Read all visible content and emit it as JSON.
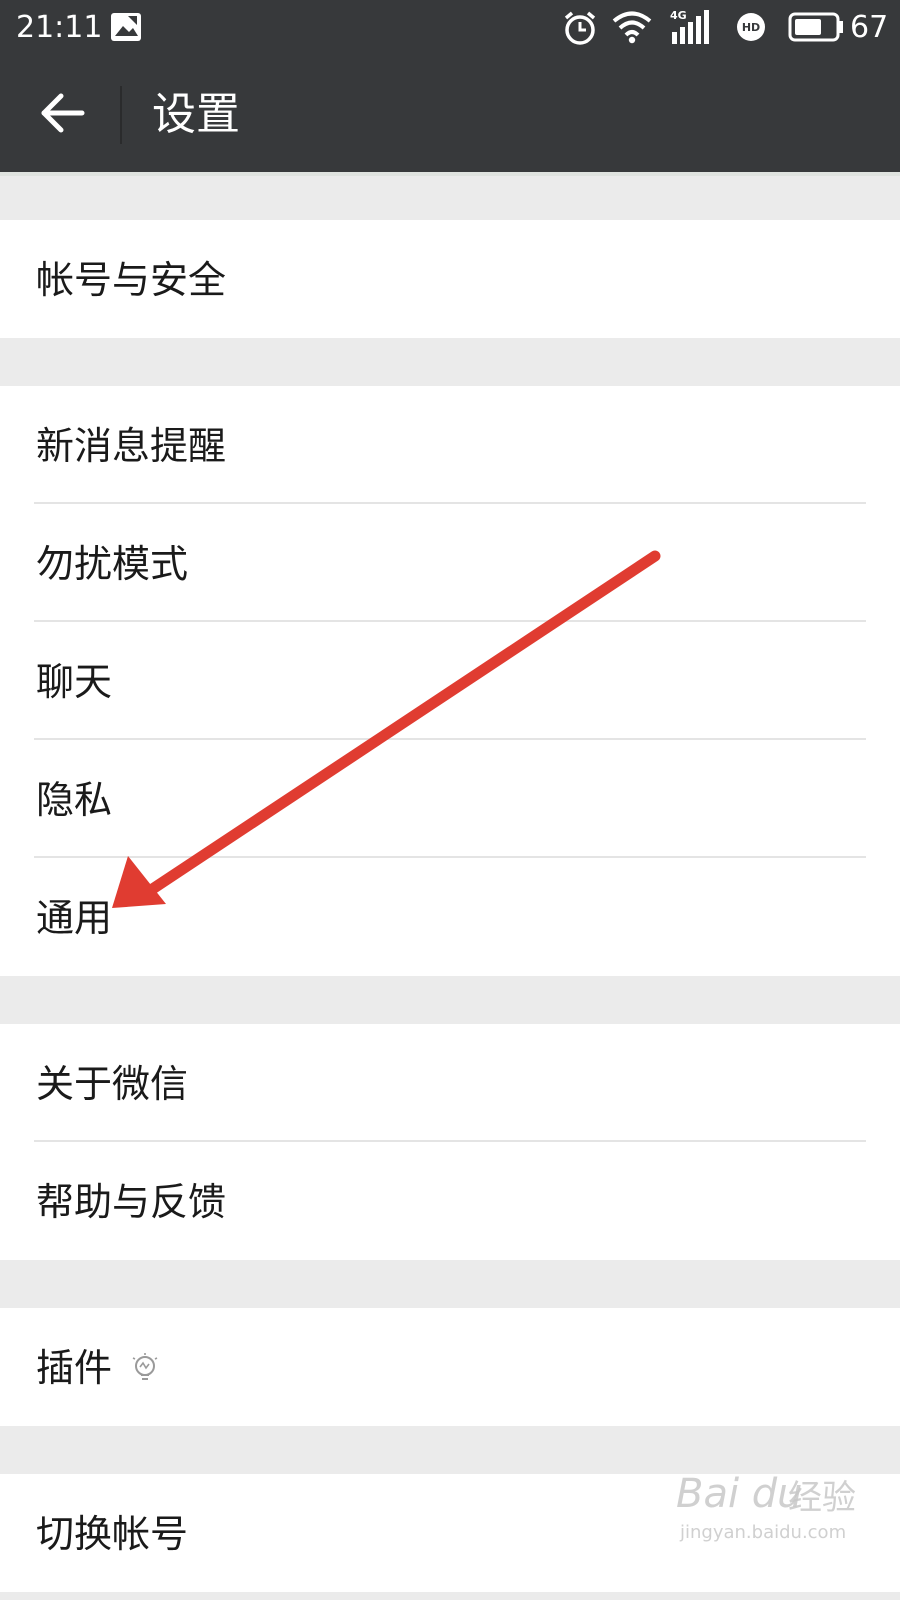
{
  "status_bar": {
    "time": "21:11",
    "network_label": "4G",
    "hd_label": "HD",
    "battery_level": "67",
    "icons": [
      "notification-image-icon",
      "alarm-icon",
      "wifi-icon",
      "signal-4g-icon",
      "hd-call-icon",
      "battery-icon"
    ]
  },
  "app_bar": {
    "title": "设置",
    "back_icon": "arrow-left-icon"
  },
  "groups": [
    {
      "items": [
        {
          "label": "帐号与安全"
        }
      ]
    },
    {
      "items": [
        {
          "label": "新消息提醒"
        },
        {
          "label": "勿扰模式"
        },
        {
          "label": "聊天"
        },
        {
          "label": "隐私"
        },
        {
          "label": "通用"
        }
      ]
    },
    {
      "items": [
        {
          "label": "关于微信"
        },
        {
          "label": "帮助与反馈"
        }
      ]
    },
    {
      "items": [
        {
          "label": "插件",
          "icon": "lightbulb-icon"
        }
      ]
    },
    {
      "items": [
        {
          "label": "切换帐号"
        }
      ]
    }
  ],
  "annotation": {
    "arrow_color": "#e03c31"
  },
  "watermark": {
    "brand": "Bai du",
    "service": "经验",
    "url": "jingyan.baidu.com"
  },
  "colors": {
    "app_bar": "#37393b",
    "background": "#ebebeb",
    "row_background": "#ffffff",
    "text": "#1a1a1a"
  }
}
